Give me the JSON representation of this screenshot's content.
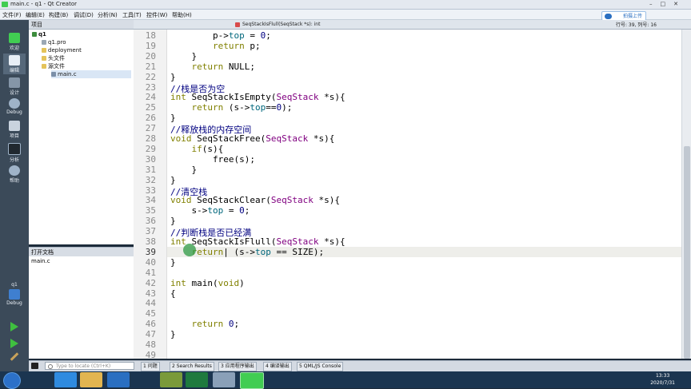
{
  "window": {
    "title": "main.c - q1 - Qt Creator"
  },
  "menu": [
    "文件(F)",
    "编辑(E)",
    "构建(B)",
    "调试(D)",
    "分析(N)",
    "工具(T)",
    "控件(W)",
    "帮助(H)"
  ],
  "modes": [
    {
      "label": "欢迎",
      "icon": "qt-logo-icon"
    },
    {
      "label": "编辑",
      "icon": "edit-document-icon"
    },
    {
      "label": "设计",
      "icon": "design-icon"
    },
    {
      "label": "Debug",
      "icon": "debug-bug-icon"
    },
    {
      "label": "项目",
      "icon": "project-wrench-icon"
    },
    {
      "label": "分析",
      "icon": "analyze-icon"
    },
    {
      "label": "帮助",
      "icon": "help-icon"
    }
  ],
  "kit": {
    "project": "q1",
    "mode": "Debug"
  },
  "project_panel": {
    "header": "项目",
    "tree": [
      "q1",
      "q1.pro",
      "deployment",
      "头文件",
      "源文件",
      "main.c"
    ]
  },
  "open_docs": {
    "header": "打开文档",
    "items": [
      "main.c"
    ]
  },
  "editor": {
    "tab_label": "SeqStackIsFlull(SeqStack *s): int",
    "cursor": {
      "line_label": "行号: 39,",
      "col_label": "列号: 16"
    },
    "upload_button": "拍摄上传",
    "current_line": "39",
    "lines": [
      {
        "n": "18",
        "html": "        p-><span class='fn'>top</span> = <span class='nm'>0</span>;"
      },
      {
        "n": "19",
        "html": "        <span class='kw'>return</span> p;"
      },
      {
        "n": "20",
        "html": "    }"
      },
      {
        "n": "21",
        "html": "    <span class='kw'>return</span> NULL;"
      },
      {
        "n": "22",
        "html": "}"
      },
      {
        "n": "23",
        "html": "<span class='cm'>//栈是否为空</span>"
      },
      {
        "n": "24",
        "html": "<span class='kw'>int</span> SeqStackIsEmpty(<span class='ty'>SeqStack</span> *s){"
      },
      {
        "n": "25",
        "html": "    <span class='kw'>return</span> (s-><span class='fn'>top</span>==<span class='nm'>0</span>);"
      },
      {
        "n": "26",
        "html": "}"
      },
      {
        "n": "27",
        "html": "<span class='cm'>//释放栈的内存空间</span>"
      },
      {
        "n": "28",
        "html": "<span class='kw'>void</span> SeqStackFree(<span class='ty'>SeqStack</span> *s){"
      },
      {
        "n": "29",
        "html": "    <span class='kw'>if</span>(s){"
      },
      {
        "n": "30",
        "html": "        free(s);"
      },
      {
        "n": "31",
        "html": "    }"
      },
      {
        "n": "32",
        "html": "}"
      },
      {
        "n": "33",
        "html": "<span class='cm'>//清空栈</span>"
      },
      {
        "n": "34",
        "html": "<span class='kw'>void</span> SeqStackClear(<span class='ty'>SeqStack</span> *s){"
      },
      {
        "n": "35",
        "html": "    s-><span class='fn'>top</span> = <span class='nm'>0</span>;"
      },
      {
        "n": "36",
        "html": "}"
      },
      {
        "n": "37",
        "html": "<span class='cm'>//判断栈是否已经满</span>"
      },
      {
        "n": "38",
        "html": "<span class='kw'>int</span> SeqStackIsFlull(<span class='ty'>SeqStack</span> *s){"
      },
      {
        "n": "39",
        "html": "    <span class='kw'>return</span>| (s-><span class='fn'>top</span> == SIZE);"
      },
      {
        "n": "40",
        "html": "}"
      },
      {
        "n": "41",
        "html": ""
      },
      {
        "n": "42",
        "html": "<span class='kw'>int</span> main(<span class='kw'>void</span>)"
      },
      {
        "n": "43",
        "html": "{"
      },
      {
        "n": "44",
        "html": ""
      },
      {
        "n": "45",
        "html": ""
      },
      {
        "n": "46",
        "html": "    <span class='kw'>return</span> <span class='nm'>0</span>;"
      },
      {
        "n": "47",
        "html": "}"
      },
      {
        "n": "48",
        "html": ""
      },
      {
        "n": "49",
        "html": ""
      }
    ]
  },
  "statusbar": {
    "locate_placeholder": "Type to locate (Ctrl+K)",
    "panes": [
      "1 问题",
      "2 Search Results",
      "3 应用程序输出",
      "4 编译输出",
      "5 QML/JS Console"
    ]
  },
  "taskbar": {
    "time": "13:33",
    "date": "2020/7/31"
  },
  "colors": {
    "accent": "#41cd52",
    "keyword": "#808000",
    "type": "#800080",
    "comment": "#000080"
  }
}
